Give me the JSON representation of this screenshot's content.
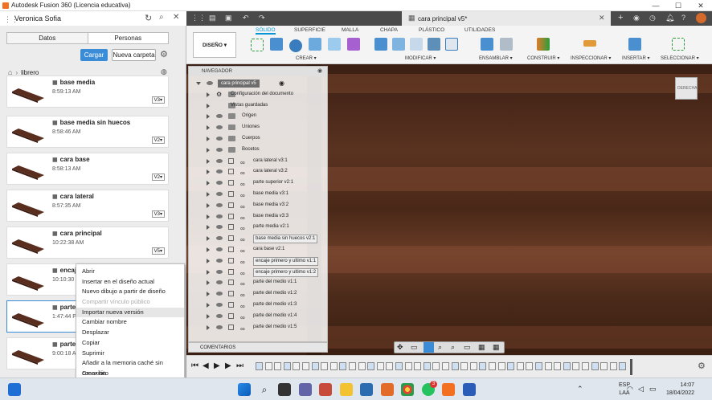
{
  "window": {
    "title": "Autodesk Fusion 360 (Licencia educativa)",
    "min": "—",
    "max": "☐",
    "close": "✕"
  },
  "left_panel": {
    "user": "Veronica Sofia",
    "tabs": [
      "Datos",
      "Personas"
    ],
    "upload_label": "Cargar",
    "new_folder_label": "Nueva carpeta",
    "folder": "librero",
    "items": [
      {
        "name": "base media",
        "time": "8:59:13 AM",
        "version": "V3"
      },
      {
        "name": "base media sin huecos",
        "time": "8:58:46 AM",
        "version": "V2"
      },
      {
        "name": "cara base",
        "time": "8:58:13 AM",
        "version": "V2"
      },
      {
        "name": "cara lateral",
        "time": "8:57:35 AM",
        "version": "V3"
      },
      {
        "name": "cara principal",
        "time": "10:22:38 AM",
        "version": "V5"
      },
      {
        "name": "encaje p",
        "time": "10:10:30 AM",
        "version": ""
      },
      {
        "name": "parte del",
        "time": "1:47:44 PM",
        "version": ""
      },
      {
        "name": "parte me",
        "time": "9:00:18 AM",
        "version": ""
      }
    ]
  },
  "context_menu": {
    "items": [
      {
        "label": "Abrir",
        "disabled": false
      },
      {
        "label": "Insertar en el diseño actual",
        "disabled": false
      },
      {
        "label": "Nuevo dibujo a partir de diseño",
        "disabled": false
      },
      {
        "label": "Compartir vínculo público",
        "disabled": true
      },
      {
        "label": "Importar nueva versión",
        "disabled": false
      },
      {
        "label": "Cambiar nombre",
        "disabled": false
      },
      {
        "label": "Desplazar",
        "disabled": false
      },
      {
        "label": "Copiar",
        "disabled": false
      },
      {
        "label": "Suprimir",
        "disabled": false
      },
      {
        "label": "Añadir a la memoria caché sin conexión",
        "disabled": false
      },
      {
        "label": "Crear hito",
        "disabled": false
      }
    ]
  },
  "doc_tab": {
    "title": "cara principal v5*"
  },
  "ribbon": {
    "workspace": "DISEÑO ▾",
    "tabs": [
      "SÓLIDO",
      "SUPERFICIE",
      "MALLA",
      "CHAPA",
      "PLÁSTICO",
      "UTILIDADES"
    ],
    "groups": [
      "CREAR ▾",
      "MODIFICAR ▾",
      "ENSAMBLAR ▾",
      "CONSTRUIR ▾",
      "INSPECCIONAR ▾",
      "INSERTAR ▾",
      "SELECCIONAR ▾"
    ]
  },
  "navigator": {
    "title": "NAVEGADOR",
    "root": "cara principal v5",
    "folders": [
      "Configuración del documento",
      "Vistas guardadas",
      "Origen",
      "Uniones",
      "Cuerpos",
      "Bocetos"
    ],
    "components": [
      "cara lateral v3:1",
      "cara lateral v3:2",
      "parte superior v2:1",
      "base media v3:1",
      "base media v3:2",
      "base media v3:3",
      "parte media v2:1",
      "base media sin huecos v2:1",
      "cara base v2:1",
      "encaje primero y ultimo v1:1",
      "encaje primero y ultimo v1:2",
      "parte del medio v1:1",
      "parte del medio v1:2",
      "parte del medio v1:3",
      "parte del medio v1:4",
      "parte del medio v1:5"
    ]
  },
  "comments": {
    "label": "COMENTARIOS"
  },
  "viewcube": {
    "label": "DERECHA"
  },
  "taskbar": {
    "lang1": "ESP",
    "lang2": "LAA",
    "time": "14:07",
    "date": "18/04/2022",
    "badge": "3"
  }
}
